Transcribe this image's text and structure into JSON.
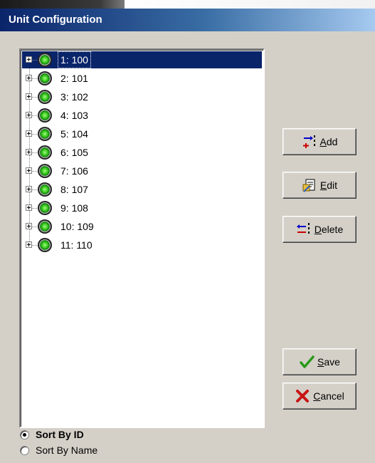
{
  "window": {
    "title": "Unit Configuration"
  },
  "tree": {
    "selected_index": 0,
    "items": [
      {
        "label": "1: 100"
      },
      {
        "label": "2: 101"
      },
      {
        "label": "3: 102"
      },
      {
        "label": "4: 103"
      },
      {
        "label": "5: 104"
      },
      {
        "label": "6: 105"
      },
      {
        "label": "7: 106"
      },
      {
        "label": "8: 107"
      },
      {
        "label": "9: 108"
      },
      {
        "label": "10: 109"
      },
      {
        "label": "11: 110"
      }
    ],
    "node_icon": "green-status-icon",
    "expander_icon": "plus-expander-icon"
  },
  "buttons": {
    "add": {
      "label_mnemonic": "A",
      "label_rest": "dd",
      "icon": "add-row-icon"
    },
    "edit": {
      "label_mnemonic": "E",
      "label_rest": "dit",
      "icon": "edit-document-icon"
    },
    "delete": {
      "label_mnemonic": "D",
      "label_rest": "elete",
      "icon": "delete-row-icon"
    },
    "save": {
      "label_mnemonic": "S",
      "label_rest": "ave",
      "icon": "checkmark-icon"
    },
    "cancel": {
      "label_mnemonic": "C",
      "label_rest": "ancel",
      "icon": "red-x-icon"
    }
  },
  "sort": {
    "selected": "id",
    "by_id_label": "Sort By ID",
    "by_name_label": "Sort By Name"
  },
  "colors": {
    "selection": "#0a246a",
    "status_green": "#35c21a",
    "face": "#d4d0c8"
  }
}
